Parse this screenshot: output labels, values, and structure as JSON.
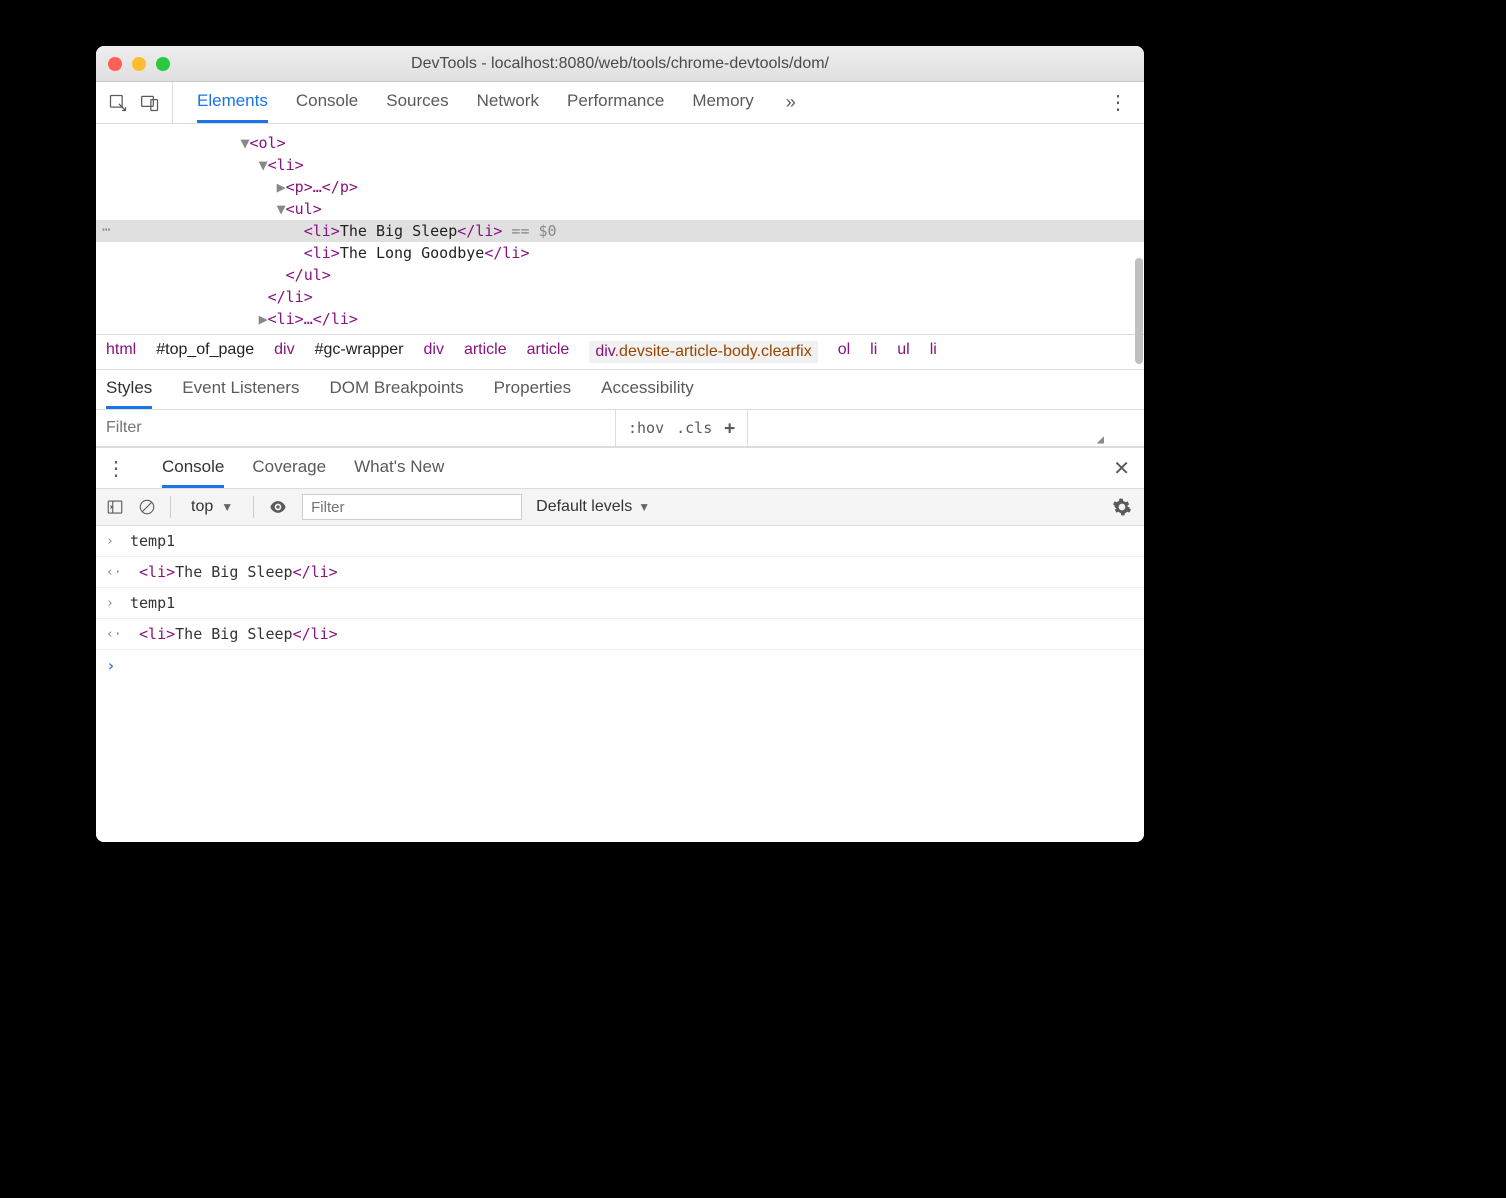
{
  "titlebar": {
    "title": "DevTools - localhost:8080/web/tools/chrome-devtools/dom/"
  },
  "tabs": {
    "elements": "Elements",
    "console": "Console",
    "sources": "Sources",
    "network": "Network",
    "performance": "Performance",
    "memory": "Memory",
    "overflow": "»"
  },
  "dom": {
    "ol_open": "<ol>",
    "li_open": "<li>",
    "p_collapsed": "<p>…</p>",
    "ul_open": "<ul>",
    "li_big_sleep_pre": "<li>",
    "li_big_sleep_text": "The Big Sleep",
    "li_big_sleep_post": "</li>",
    "eq_zero": " == $0",
    "li_long_goodbye_pre": "<li>",
    "li_long_goodbye_text": "The Long Goodbye",
    "li_long_goodbye_post": "</li>",
    "ul_close": "</ul>",
    "li_close": "</li>",
    "li2_collapsed": "<li>…</li>"
  },
  "breadcrumb": {
    "b1": "html",
    "b2": "#top_of_page",
    "b3": "div",
    "b4": "#gc-wrapper",
    "b5": "div",
    "b6": "article",
    "b7": "article",
    "b8_el": "div",
    "b8_cls": ".devsite-article-body.clearfix",
    "b9": "ol",
    "b10": "li",
    "b11": "ul",
    "b12": "li"
  },
  "styles_tabs": {
    "styles": "Styles",
    "listeners": "Event Listeners",
    "dom_bp": "DOM Breakpoints",
    "props": "Properties",
    "a11y": "Accessibility"
  },
  "filter": {
    "placeholder": "Filter",
    "hov": ":hov",
    "cls": ".cls"
  },
  "drawer": {
    "console": "Console",
    "coverage": "Coverage",
    "whatsnew": "What's New"
  },
  "console_toolbar": {
    "context": "top",
    "filter_placeholder": "Filter",
    "levels": "Default levels"
  },
  "console": {
    "temp1_a": "temp1",
    "out_a_pre": "<li>",
    "out_a_text": "The Big Sleep",
    "out_a_post": "</li>",
    "temp1_b": "temp1",
    "out_b_pre": "<li>",
    "out_b_text": "The Big Sleep",
    "out_b_post": "</li>"
  }
}
